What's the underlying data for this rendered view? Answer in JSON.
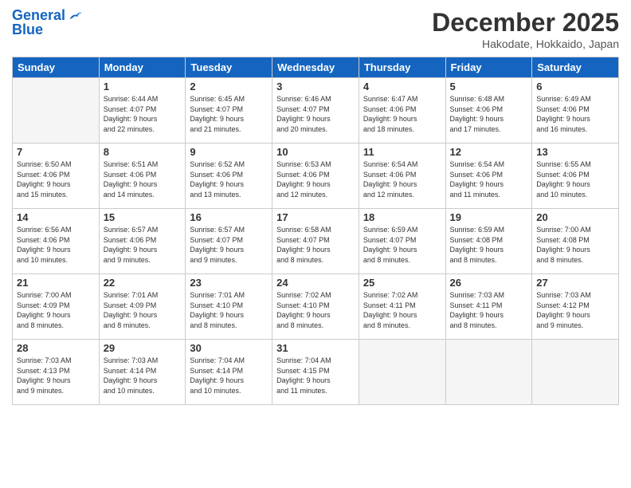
{
  "header": {
    "logo_line1": "General",
    "logo_line2": "Blue",
    "month_title": "December 2025",
    "location": "Hakodate, Hokkaido, Japan"
  },
  "weekdays": [
    "Sunday",
    "Monday",
    "Tuesday",
    "Wednesday",
    "Thursday",
    "Friday",
    "Saturday"
  ],
  "weeks": [
    [
      {
        "day": "",
        "info": ""
      },
      {
        "day": "1",
        "info": "Sunrise: 6:44 AM\nSunset: 4:07 PM\nDaylight: 9 hours\nand 22 minutes."
      },
      {
        "day": "2",
        "info": "Sunrise: 6:45 AM\nSunset: 4:07 PM\nDaylight: 9 hours\nand 21 minutes."
      },
      {
        "day": "3",
        "info": "Sunrise: 6:46 AM\nSunset: 4:07 PM\nDaylight: 9 hours\nand 20 minutes."
      },
      {
        "day": "4",
        "info": "Sunrise: 6:47 AM\nSunset: 4:06 PM\nDaylight: 9 hours\nand 18 minutes."
      },
      {
        "day": "5",
        "info": "Sunrise: 6:48 AM\nSunset: 4:06 PM\nDaylight: 9 hours\nand 17 minutes."
      },
      {
        "day": "6",
        "info": "Sunrise: 6:49 AM\nSunset: 4:06 PM\nDaylight: 9 hours\nand 16 minutes."
      }
    ],
    [
      {
        "day": "7",
        "info": "Sunrise: 6:50 AM\nSunset: 4:06 PM\nDaylight: 9 hours\nand 15 minutes."
      },
      {
        "day": "8",
        "info": "Sunrise: 6:51 AM\nSunset: 4:06 PM\nDaylight: 9 hours\nand 14 minutes."
      },
      {
        "day": "9",
        "info": "Sunrise: 6:52 AM\nSunset: 4:06 PM\nDaylight: 9 hours\nand 13 minutes."
      },
      {
        "day": "10",
        "info": "Sunrise: 6:53 AM\nSunset: 4:06 PM\nDaylight: 9 hours\nand 12 minutes."
      },
      {
        "day": "11",
        "info": "Sunrise: 6:54 AM\nSunset: 4:06 PM\nDaylight: 9 hours\nand 12 minutes."
      },
      {
        "day": "12",
        "info": "Sunrise: 6:54 AM\nSunset: 4:06 PM\nDaylight: 9 hours\nand 11 minutes."
      },
      {
        "day": "13",
        "info": "Sunrise: 6:55 AM\nSunset: 4:06 PM\nDaylight: 9 hours\nand 10 minutes."
      }
    ],
    [
      {
        "day": "14",
        "info": "Sunrise: 6:56 AM\nSunset: 4:06 PM\nDaylight: 9 hours\nand 10 minutes."
      },
      {
        "day": "15",
        "info": "Sunrise: 6:57 AM\nSunset: 4:06 PM\nDaylight: 9 hours\nand 9 minutes."
      },
      {
        "day": "16",
        "info": "Sunrise: 6:57 AM\nSunset: 4:07 PM\nDaylight: 9 hours\nand 9 minutes."
      },
      {
        "day": "17",
        "info": "Sunrise: 6:58 AM\nSunset: 4:07 PM\nDaylight: 9 hours\nand 8 minutes."
      },
      {
        "day": "18",
        "info": "Sunrise: 6:59 AM\nSunset: 4:07 PM\nDaylight: 9 hours\nand 8 minutes."
      },
      {
        "day": "19",
        "info": "Sunrise: 6:59 AM\nSunset: 4:08 PM\nDaylight: 9 hours\nand 8 minutes."
      },
      {
        "day": "20",
        "info": "Sunrise: 7:00 AM\nSunset: 4:08 PM\nDaylight: 9 hours\nand 8 minutes."
      }
    ],
    [
      {
        "day": "21",
        "info": "Sunrise: 7:00 AM\nSunset: 4:09 PM\nDaylight: 9 hours\nand 8 minutes."
      },
      {
        "day": "22",
        "info": "Sunrise: 7:01 AM\nSunset: 4:09 PM\nDaylight: 9 hours\nand 8 minutes."
      },
      {
        "day": "23",
        "info": "Sunrise: 7:01 AM\nSunset: 4:10 PM\nDaylight: 9 hours\nand 8 minutes."
      },
      {
        "day": "24",
        "info": "Sunrise: 7:02 AM\nSunset: 4:10 PM\nDaylight: 9 hours\nand 8 minutes."
      },
      {
        "day": "25",
        "info": "Sunrise: 7:02 AM\nSunset: 4:11 PM\nDaylight: 9 hours\nand 8 minutes."
      },
      {
        "day": "26",
        "info": "Sunrise: 7:03 AM\nSunset: 4:11 PM\nDaylight: 9 hours\nand 8 minutes."
      },
      {
        "day": "27",
        "info": "Sunrise: 7:03 AM\nSunset: 4:12 PM\nDaylight: 9 hours\nand 9 minutes."
      }
    ],
    [
      {
        "day": "28",
        "info": "Sunrise: 7:03 AM\nSunset: 4:13 PM\nDaylight: 9 hours\nand 9 minutes."
      },
      {
        "day": "29",
        "info": "Sunrise: 7:03 AM\nSunset: 4:14 PM\nDaylight: 9 hours\nand 10 minutes."
      },
      {
        "day": "30",
        "info": "Sunrise: 7:04 AM\nSunset: 4:14 PM\nDaylight: 9 hours\nand 10 minutes."
      },
      {
        "day": "31",
        "info": "Sunrise: 7:04 AM\nSunset: 4:15 PM\nDaylight: 9 hours\nand 11 minutes."
      },
      {
        "day": "",
        "info": ""
      },
      {
        "day": "",
        "info": ""
      },
      {
        "day": "",
        "info": ""
      }
    ]
  ]
}
